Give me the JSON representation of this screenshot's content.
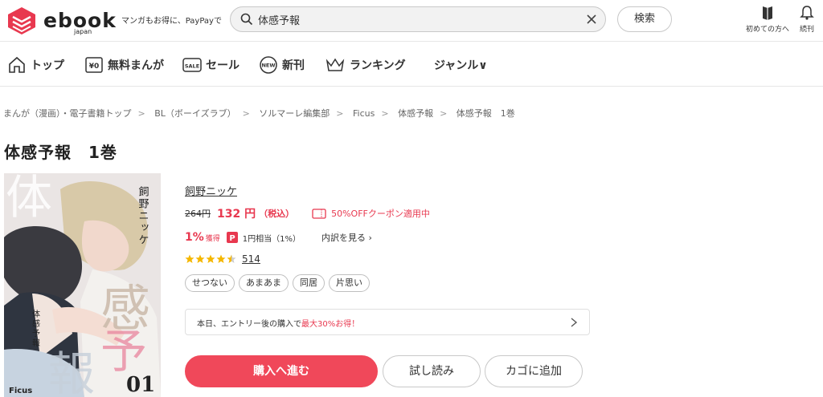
{
  "header": {
    "logo_text": "ebook",
    "logo_sub": "japan",
    "tagline": "マンガもお得に、PayPayで",
    "search_value": "体感予報",
    "search_button": "検索",
    "beginner_label": "初めての方へ",
    "follow_label": "続刊"
  },
  "nav": [
    {
      "label": "トップ"
    },
    {
      "label": "無料まんが"
    },
    {
      "label": "セール"
    },
    {
      "label": "新刊"
    },
    {
      "label": "ランキング"
    },
    {
      "label": "ジャンル∨"
    }
  ],
  "breadcrumb": [
    "まんが（漫画）・電子書籍トップ",
    "BL（ボーイズラブ）",
    "ソルマーレ編集部",
    "Ficus",
    "体感予報",
    "体感予報　1巻"
  ],
  "breadcrumb_sep": ">",
  "title": "体感予報　1巻",
  "cover": {
    "big_kanji_1": "体",
    "big_kanji_2": "感",
    "big_kanji_3": "報",
    "big_kanji_4": "予",
    "vertical_author": "飼野ニッケ",
    "vertical_title": "体感予報",
    "volume": "01",
    "publisher": "Ficus"
  },
  "product": {
    "author": "飼野ニッケ",
    "original_price": "264円",
    "price": "132 円",
    "price_tax": "（税込）",
    "coupon_text": "50%OFFクーポン適用中",
    "point_pct": "1%",
    "point_get": "獲得",
    "point_amount": "1円相当（1%）",
    "detail_link": "内訳を見る",
    "rating": 4.5,
    "review_count": "514",
    "tags": [
      "せつない",
      "あまあま",
      "同居",
      "片思い"
    ],
    "campaign_prefix": "本日、エントリー後の購入で",
    "campaign_highlight": "最大30%お得！",
    "buy_button": "購入へ進む",
    "trial_button": "試し読み",
    "cart_button": "カゴに追加"
  },
  "colors": {
    "accent": "#e8384f",
    "buy_button": "#f0485a",
    "star": "#f5b700"
  }
}
